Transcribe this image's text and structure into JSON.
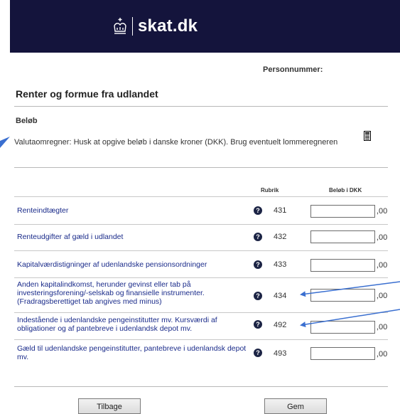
{
  "header": {
    "brand": "skat.dk",
    "logo_icon": "crown-icon",
    "background": "#14143c"
  },
  "personal_number_label": "Personnummer:",
  "page_title": "Renter og formue fra udlandet",
  "section_title": "Beløb",
  "currency_note": "Valutaomregner: Husk at opgive beløb i danske kroner (DKK). Brug eventuelt lommeregneren",
  "calculator_icon": "calculator-icon",
  "table": {
    "col_rubrik": "Rubrik",
    "col_amount": "Beløb i DKK",
    "help_symbol": "?",
    "rows": [
      {
        "label": "Renteindtægter",
        "rubrik": "431",
        "value": "",
        "decimals": ",00"
      },
      {
        "label": "Renteudgifter af gæld i udlandet",
        "rubrik": "432",
        "value": "",
        "decimals": ",00"
      },
      {
        "label": "Kapitalværdistigninger af udenlandske pensionsordninger",
        "rubrik": "433",
        "value": "",
        "decimals": ",00"
      },
      {
        "label": "Anden kapitalindkomst, herunder gevinst eller tab på investeringsforening/-selskab og finansielle instrumenter. (Fradragsberettiget tab angives med minus)",
        "rubrik": "434",
        "value": "",
        "decimals": ",00"
      },
      {
        "label": "Indestående i udenlandske pengeinstitutter mv. Kursværdi af obligationer og af pantebreve i udenlandsk depot mv.",
        "rubrik": "492",
        "value": "",
        "decimals": ",00"
      },
      {
        "label": "Gæld til udenlandske pengeinstitutter, pantebreve i udenlandsk depot mv.",
        "rubrik": "493",
        "value": "",
        "decimals": ",00"
      }
    ]
  },
  "buttons": {
    "back": "Tilbage",
    "save": "Gem"
  },
  "annotation_color": "#3a6fd0"
}
